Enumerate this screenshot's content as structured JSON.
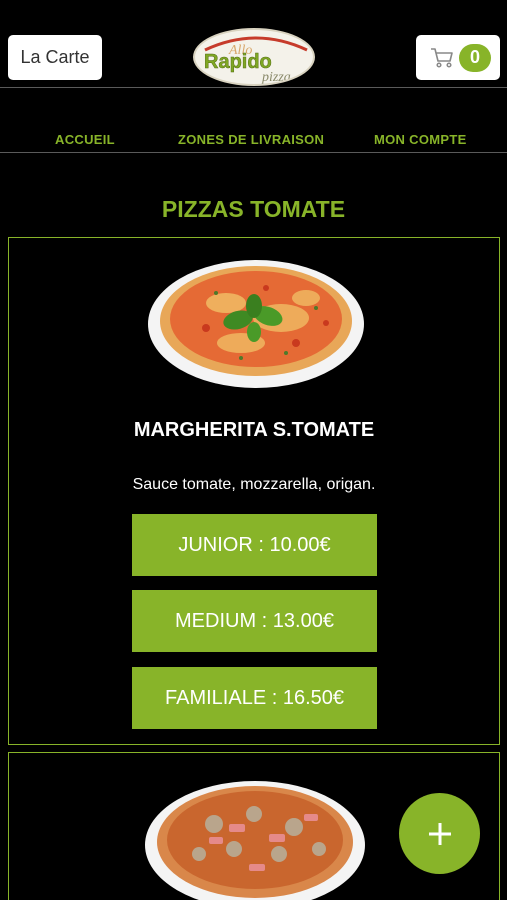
{
  "header": {
    "menu_button_label": "La Carte",
    "logo": {
      "line1": "Allo",
      "line2": "Rapido",
      "line3": "pizza"
    },
    "cart": {
      "icon": "cart-icon",
      "count": "0"
    }
  },
  "nav": {
    "items": [
      {
        "label": "ACCUEIL"
      },
      {
        "label": "ZONES DE LIVRAISON"
      },
      {
        "label": "MON COMPTE"
      }
    ]
  },
  "section": {
    "title": "PIZZAS TOMATE"
  },
  "products": [
    {
      "name": "MARGHERITA S.TOMATE",
      "description": "Sauce tomate, mozzarella, origan.",
      "sizes": [
        {
          "label": "JUNIOR : 10.00€"
        },
        {
          "label": "MEDIUM : 13.00€"
        },
        {
          "label": "FAMILIALE : 16.50€"
        }
      ]
    }
  ],
  "fab": {
    "icon": "plus-icon"
  },
  "colors": {
    "accent": "#88b429",
    "background": "#000000",
    "text": "#ffffff"
  }
}
